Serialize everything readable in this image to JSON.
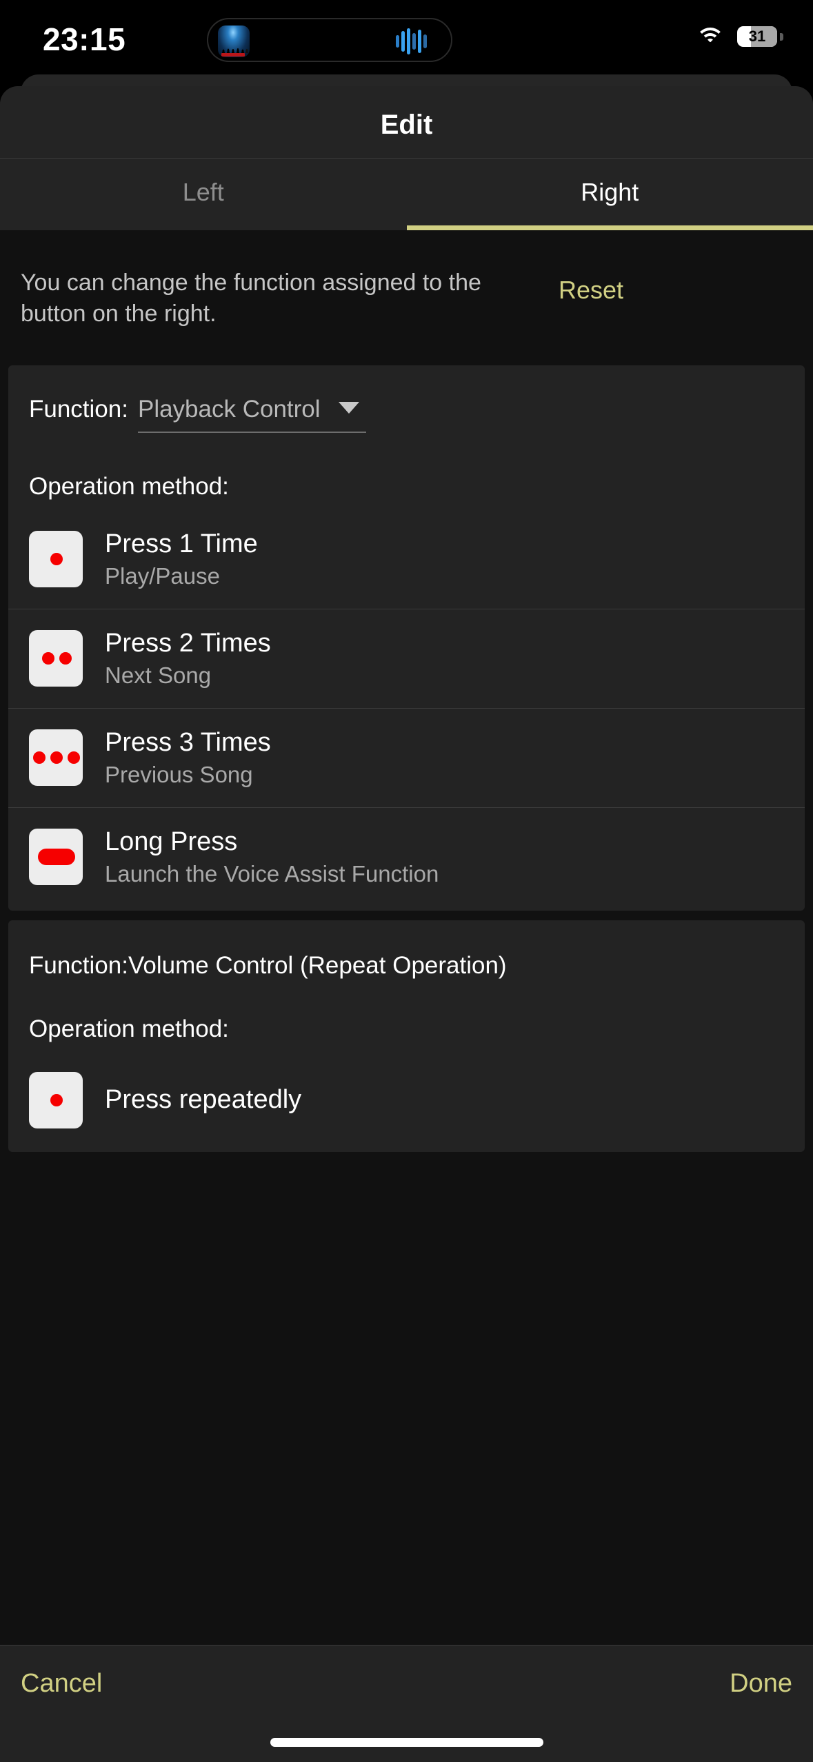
{
  "status_bar": {
    "time": "23:15",
    "battery_percent": "31",
    "wifi_icon": "wifi-icon",
    "battery_icon": "battery-icon",
    "dynamic_island": {
      "album_art_icon": "album-art-thumbnail",
      "waveform_icon": "audio-waveform-icon"
    }
  },
  "sheet": {
    "title": "Edit",
    "tabs": [
      {
        "label": "Left",
        "active": false
      },
      {
        "label": "Right",
        "active": true
      }
    ],
    "description": "You can change the function assigned to the button on the right.",
    "reset_label": "Reset"
  },
  "sections": [
    {
      "function_label": "Function:",
      "function_value": "Playback Control",
      "dropdown_icon": "chevron-down-icon",
      "operation_heading": "Operation method:",
      "rows": [
        {
          "icon": "press-1-time-icon",
          "dots": 1,
          "title": "Press 1 Time",
          "subtitle": "Play/Pause"
        },
        {
          "icon": "press-2-times-icon",
          "dots": 2,
          "title": "Press 2 Times",
          "subtitle": "Next Song"
        },
        {
          "icon": "press-3-times-icon",
          "dots": 3,
          "title": "Press 3 Times",
          "subtitle": "Previous Song"
        },
        {
          "icon": "long-press-icon",
          "dots": 0,
          "title": "Long Press",
          "subtitle": "Launch the Voice Assist Function"
        }
      ]
    },
    {
      "function_static": "Function:Volume Control (Repeat Operation)",
      "operation_heading": "Operation method:",
      "rows": [
        {
          "icon": "press-repeatedly-icon",
          "dots": 0,
          "title": "Press repeatedly",
          "subtitle": ""
        }
      ]
    }
  ],
  "toolbar": {
    "cancel_label": "Cancel",
    "done_label": "Done"
  },
  "colors": {
    "accent_yellow": "#d1d083",
    "dot_red": "#f60000",
    "sheet_bg": "#111111",
    "card_bg": "#232323",
    "header_bg": "#242424"
  }
}
